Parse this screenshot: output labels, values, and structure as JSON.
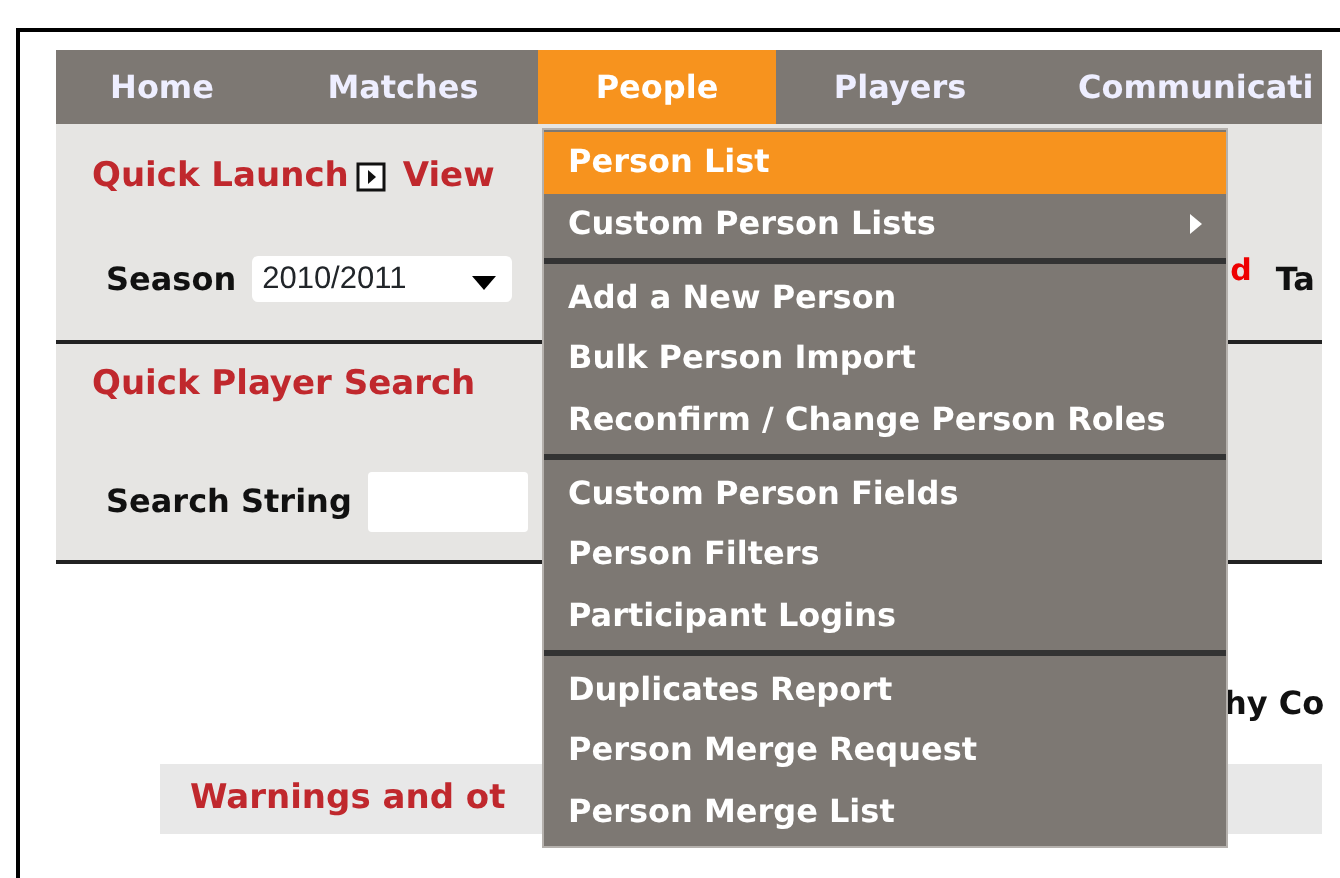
{
  "nav": [
    {
      "label": "Home",
      "selected": false
    },
    {
      "label": "Matches",
      "selected": false
    },
    {
      "label": "People",
      "selected": true
    },
    {
      "label": "Players",
      "selected": false
    },
    {
      "label": "Communicati",
      "selected": false
    }
  ],
  "quick_launch": {
    "title": "Quick Launch",
    "link": "View",
    "season_label": "Season",
    "season_value": "2010/2011",
    "column_3": "d",
    "column_4": "Ta"
  },
  "quick_player_search": {
    "title": "Quick Player Search",
    "search_label": "Search String"
  },
  "body_text": "hy Co",
  "warnings": {
    "title": "Warnings and ot"
  },
  "menu": [
    [
      {
        "label": "Person List",
        "selected": true,
        "submenu": false
      },
      {
        "label": "Custom Person Lists",
        "selected": false,
        "submenu": true
      }
    ],
    [
      {
        "label": "Add a New Person",
        "selected": false,
        "submenu": false
      },
      {
        "label": "Bulk Person Import",
        "selected": false,
        "submenu": false
      },
      {
        "label": "Reconfirm / Change Person Roles",
        "selected": false,
        "submenu": false
      }
    ],
    [
      {
        "label": "Custom Person Fields",
        "selected": false,
        "submenu": false
      },
      {
        "label": "Person Filters",
        "selected": false,
        "submenu": false
      },
      {
        "label": "Participant Logins",
        "selected": false,
        "submenu": false
      }
    ],
    [
      {
        "label": "Duplicates Report",
        "selected": false,
        "submenu": false
      },
      {
        "label": "Person Merge Request",
        "selected": false,
        "submenu": false
      },
      {
        "label": "Person Merge List",
        "selected": false,
        "submenu": false
      }
    ]
  ]
}
